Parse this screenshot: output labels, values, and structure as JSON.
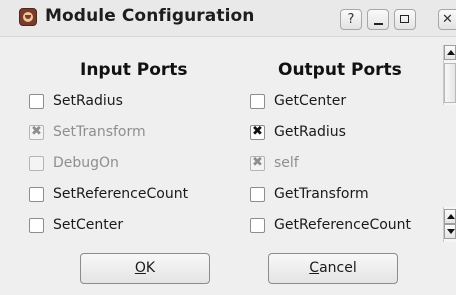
{
  "window": {
    "title": "Module Configuration",
    "app_icon": "gnome-foot-icon",
    "titlebar_buttons": [
      {
        "name": "help",
        "glyph": "?"
      },
      {
        "name": "minimize"
      },
      {
        "name": "maximize"
      },
      {
        "name": "close",
        "glyph": "✕"
      }
    ]
  },
  "input_ports": {
    "heading": "Input Ports",
    "items": [
      {
        "label": "SetRadius",
        "checked": false,
        "enabled": true
      },
      {
        "label": "SetTransform",
        "checked": true,
        "enabled": false
      },
      {
        "label": "DebugOn",
        "checked": false,
        "enabled": false
      },
      {
        "label": "SetReferenceCount",
        "checked": false,
        "enabled": true
      },
      {
        "label": "SetCenter",
        "checked": false,
        "enabled": true
      }
    ]
  },
  "output_ports": {
    "heading": "Output Ports",
    "items": [
      {
        "label": "GetCenter",
        "checked": false,
        "enabled": true
      },
      {
        "label": "GetRadius",
        "checked": true,
        "enabled": true
      },
      {
        "label": "self",
        "checked": true,
        "enabled": false
      },
      {
        "label": "GetTransform",
        "checked": false,
        "enabled": true
      },
      {
        "label": "GetReferenceCount",
        "checked": false,
        "enabled": true
      }
    ]
  },
  "buttons": {
    "ok": {
      "mnemonic": "O",
      "rest": "K"
    },
    "cancel": {
      "mnemonic": "C",
      "rest": "ancel"
    }
  }
}
